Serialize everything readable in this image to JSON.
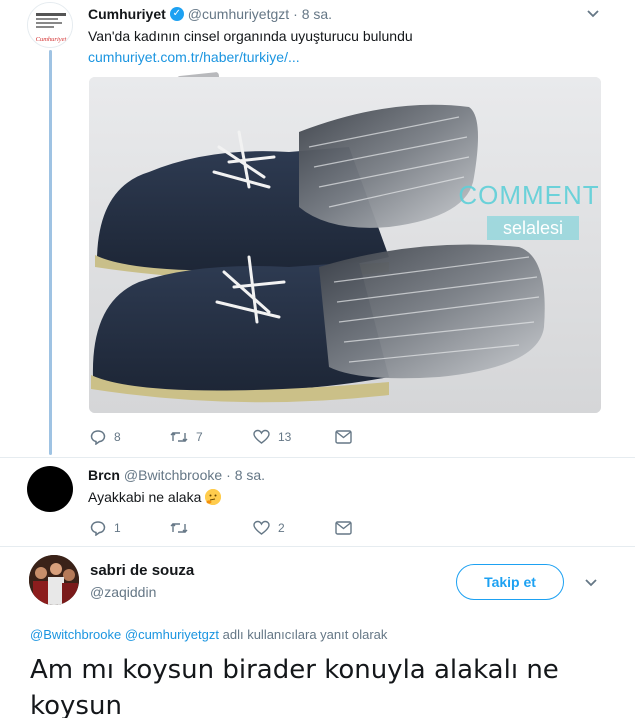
{
  "tweet1": {
    "name": "Cumhuriyet",
    "handle": "@cumhuriyetgzt",
    "time": "· 8 sa.",
    "text": "Van'da kadının cinsel organında uyuşturucu bulundu",
    "link": "cumhuriyet.com.tr/haber/turkiye/...",
    "avatar_logo_text": "Cumhuriyet",
    "watermark_line1": "COMMENT",
    "watermark_line2": "selalesi",
    "replies": "8",
    "retweets": "7",
    "likes": "13"
  },
  "tweet2": {
    "name": "Brcn",
    "handle": "@Bwitchbrooke",
    "time": "· 8 sa.",
    "text": "Ayakkabi ne alaka",
    "replies": "1",
    "retweets": "",
    "likes": "2"
  },
  "tweet3": {
    "name": "sabri de souza",
    "handle": "@zaqiddin",
    "follow_label": "Takip et",
    "reply_mention1": "@Bwitchbrooke",
    "reply_mention2": "@cumhuriyetgzt",
    "reply_suffix": "adlı kullanıcılara yanıt olarak",
    "text": "Am mı koysun birader konuyla alakalı ne koysun"
  },
  "colors": {
    "accent": "#1da1f2",
    "link": "#1b95e0",
    "muted": "#657786",
    "thread": "#9fc3e3",
    "watermark": "#5fd0d8"
  },
  "icons": [
    "chevron-down-icon",
    "verified-badge-icon",
    "reply-icon",
    "retweet-icon",
    "like-icon",
    "dm-icon"
  ]
}
